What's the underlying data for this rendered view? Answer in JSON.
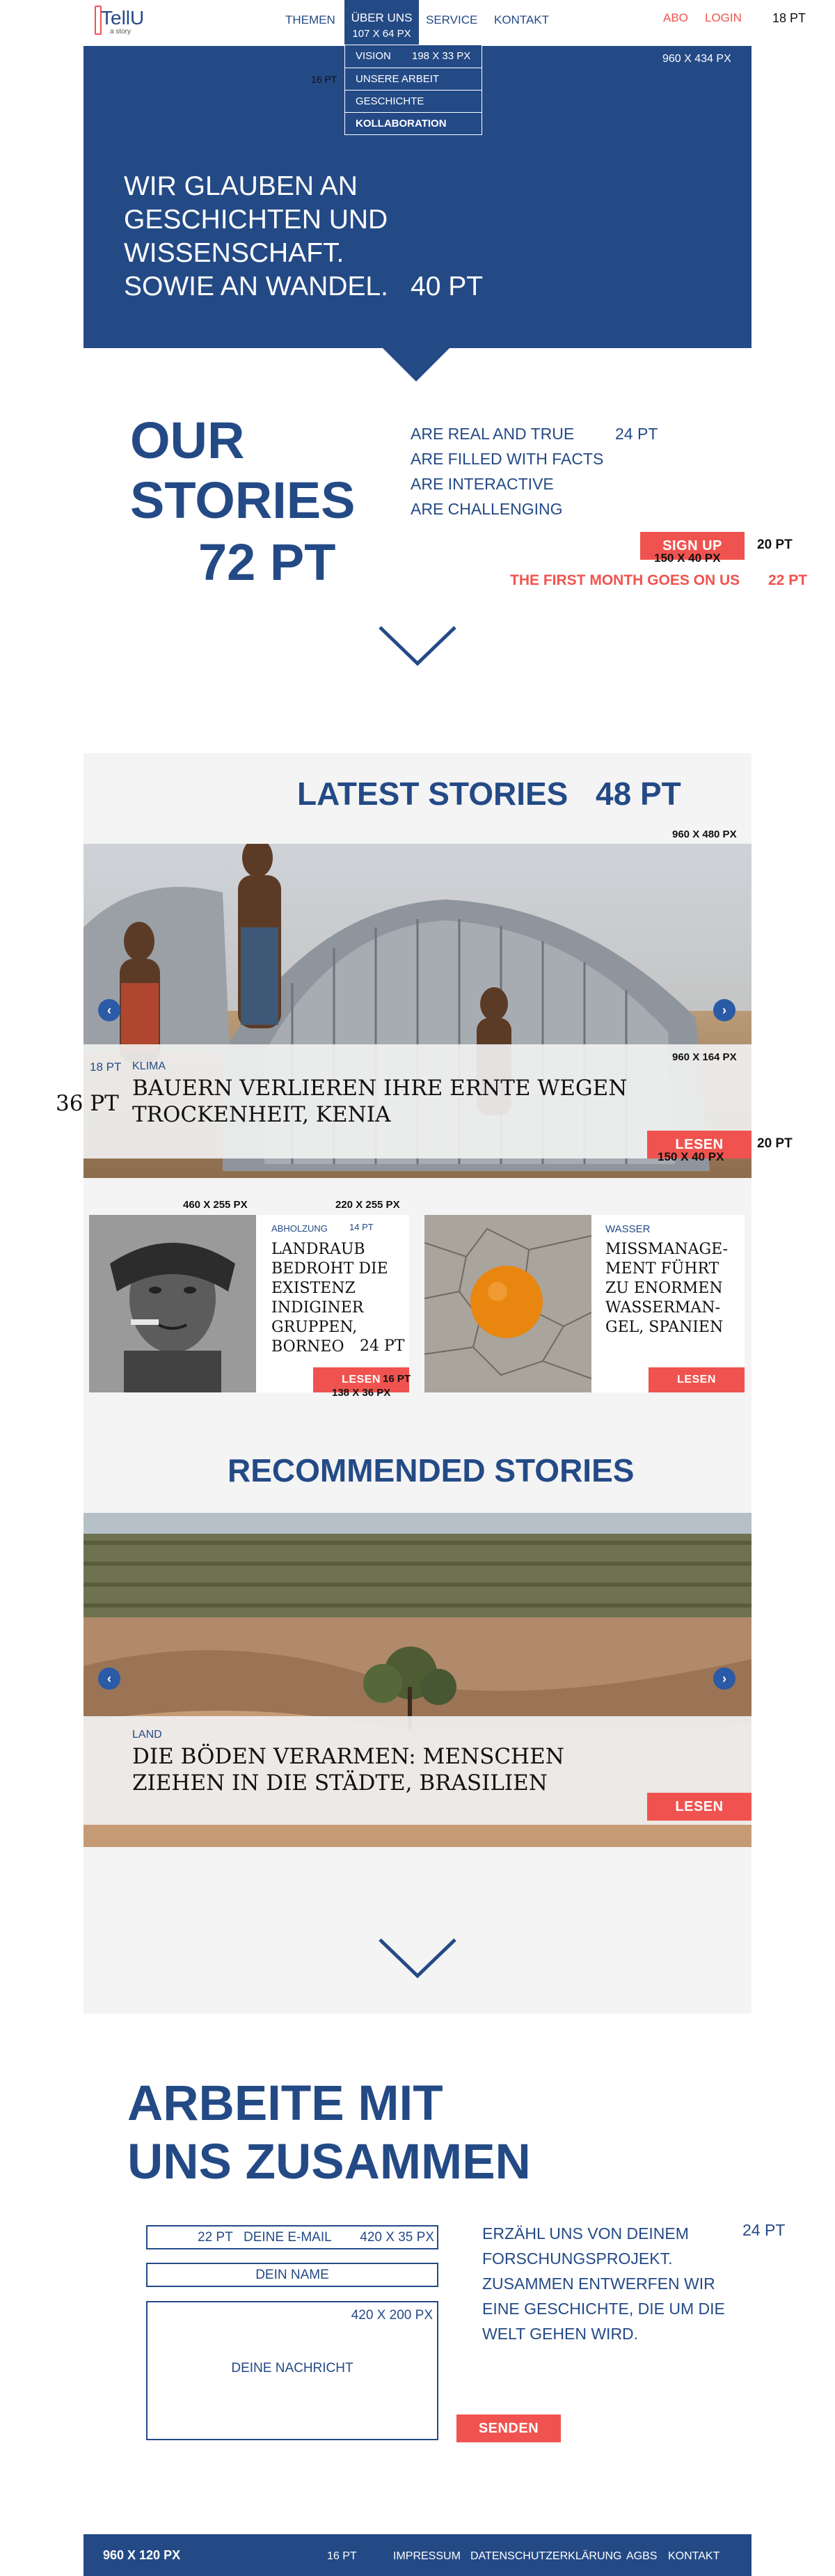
{
  "header": {
    "logo_text": "TellU",
    "logo_sub": "a story",
    "nav": [
      "THEMEN",
      "ÜBER UNS",
      "SERVICE",
      "KONTAKT"
    ],
    "active_size": "107 X 64 PX",
    "abo": "ABO",
    "login": "LOGIN",
    "font_note": "18 PT"
  },
  "dropdown": {
    "items": [
      "VISION",
      "UNSERE ARBEIT",
      "GESCHICHTE",
      "KOLLABORATION"
    ],
    "size_note": "198 X 33 PX",
    "font_note": "16 PT"
  },
  "hero": {
    "lines": [
      "WIR GLAUBEN AN",
      "GESCHICHTEN UND",
      "WISSENSCHAFT.",
      "SOWIE AN WANDEL."
    ],
    "font_note": "40 PT",
    "size_note": "960 X 434 PX"
  },
  "our_stories": {
    "title_lines": [
      "OUR",
      "STORIES"
    ],
    "font_note": "72 PT",
    "features": [
      "ARE REAL AND TRUE",
      "ARE FILLED WITH FACTS",
      "ARE INTERACTIVE",
      "ARE CHALLENGING"
    ],
    "features_note": "24 PT",
    "signup": "SIGN UP",
    "signup_font": "20 PT",
    "signup_size": "150 X 40 PX",
    "promo": "THE FIRST MONTH GOES ON US",
    "promo_font": "22 PT"
  },
  "latest": {
    "title": "LATEST STORIES",
    "font_note": "48 PT",
    "image_size": "960 X 480 PX",
    "band_size": "960 X 164 PX",
    "category_font": "18 PT",
    "title_font": "36 PT",
    "main_story": {
      "category": "KLIMA",
      "title_lines": [
        "BAUERN VERLIEREN IHRE ERNTE WEGEN",
        "TROCKENHEIT, KENIA"
      ],
      "button": "LESEN",
      "button_font": "20 PT",
      "button_size": "150 X 40 PX"
    },
    "card_left": {
      "image_size": "460 X 255 PX",
      "text_size": "220 X 255 PX",
      "category": "ABHOLZUNG",
      "category_font": "14 PT",
      "title_lines": [
        "LANDRAUB",
        "BEDROHT DIE",
        "EXISTENZ",
        "INDIGINER",
        "GRUPPEN,",
        "BORNEO"
      ],
      "title_font": "24 PT",
      "button": "LESEN",
      "button_font": "16 PT",
      "button_size": "138 X 36 PX"
    },
    "card_right": {
      "category": "WASSER",
      "title_lines": [
        "MISSMANAGE-",
        "MENT FÜHRT",
        "ZU ENORMEN",
        "WASSERMAN-",
        "GEL, SPANIEN"
      ],
      "button": "LESEN"
    }
  },
  "recommended": {
    "title": "RECOMMENDED STORIES",
    "story": {
      "category": "LAND",
      "title_lines": [
        "DIE BÖDEN VERARMEN: MENSCHEN",
        "ZIEHEN IN DIE STÄDTE, BRASILIEN"
      ],
      "button": "LESEN"
    }
  },
  "contact": {
    "title_lines": [
      "ARBEITE MIT",
      "UNS ZUSAMMEN"
    ],
    "email_placeholder": "DEINE E-MAIL",
    "email_font": "22 PT",
    "email_size": "420 X 35 PX",
    "name_placeholder": "DEIN NAME",
    "message_placeholder": "DEINE NACHRICHT",
    "message_size": "420 X 200 PX",
    "copy": "ERZÄHL UNS VON DEINEM FORSCHUNGSPROJEKT. ZUSAMMEN ENTWERFEN WIR EINE GESCHICHTE, DIE UM DIE WELT GEHEN WIRD.",
    "copy_font": "24 PT",
    "submit": "SENDEN"
  },
  "footer": {
    "size_note": "960 X 120 PX",
    "font_note": "16 PT",
    "links": [
      "IMPRESSUM",
      "DATENSCHUTZERKLÄRUNG",
      "AGBS",
      "KONTAKT"
    ]
  },
  "colors": {
    "brand_blue": "#244a86",
    "accent_red": "#f0534f",
    "panel_grey": "#f4f4f4"
  }
}
